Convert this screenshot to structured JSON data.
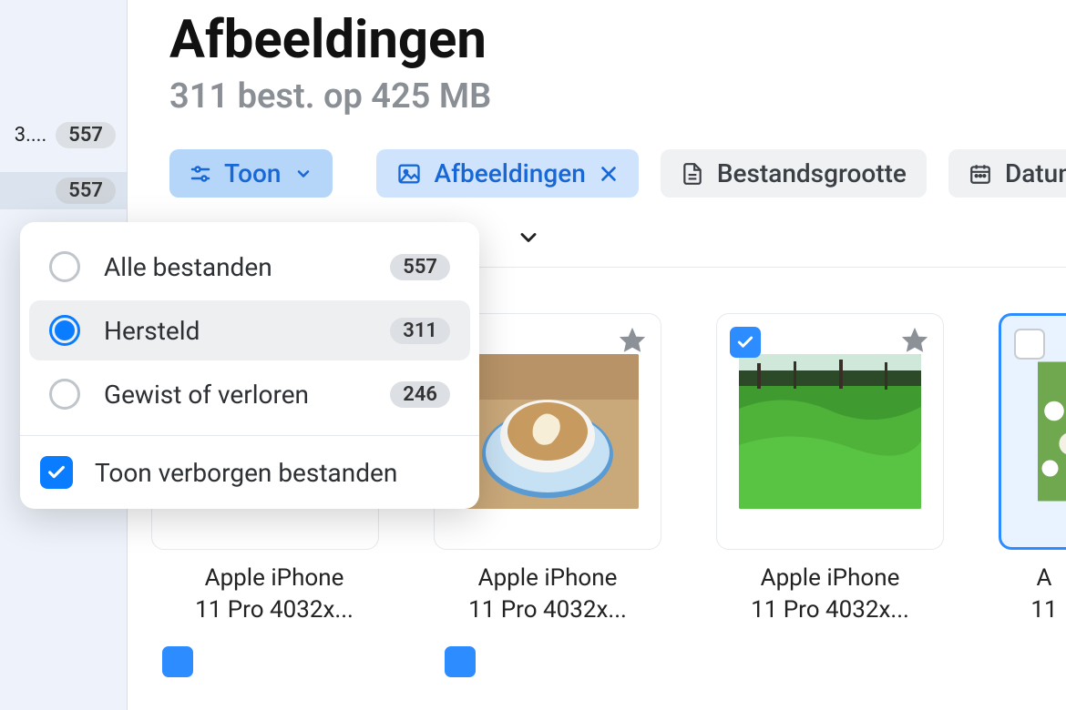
{
  "header": {
    "title": "Afbeeldingen",
    "subtitle": "311 best. op 425 MB"
  },
  "sidebar": {
    "items": [
      {
        "label": "3....",
        "count": "557"
      },
      {
        "label": "",
        "count": "557"
      }
    ]
  },
  "filters": {
    "toon": "Toon",
    "chips": [
      {
        "label": "Afbeeldingen"
      },
      {
        "label": "Bestandsgrootte"
      },
      {
        "label": "Datum"
      }
    ]
  },
  "dropdown": {
    "items": [
      {
        "label": "Alle bestanden",
        "count": "557",
        "selected": false
      },
      {
        "label": "Hersteld",
        "count": "311",
        "selected": true
      },
      {
        "label": "Gewist of verloren",
        "count": "246",
        "selected": false
      }
    ],
    "showHiddenLabel": "Toon verborgen bestanden",
    "showHiddenChecked": true
  },
  "gallery": {
    "cards": [
      {
        "caption_line1": "Apple iPhone",
        "caption_line2": "11 Pro 4032x...",
        "checked": false,
        "selected": false
      },
      {
        "caption_line1": "Apple iPhone",
        "caption_line2": "11 Pro 4032x...",
        "checked": true,
        "selected": false
      },
      {
        "caption_line1": "Apple iPhone",
        "caption_line2": "11 Pro 4032x...",
        "checked": true,
        "selected": false
      },
      {
        "caption_line1": "A",
        "caption_line2": "11",
        "checked": false,
        "selected": true
      }
    ]
  }
}
